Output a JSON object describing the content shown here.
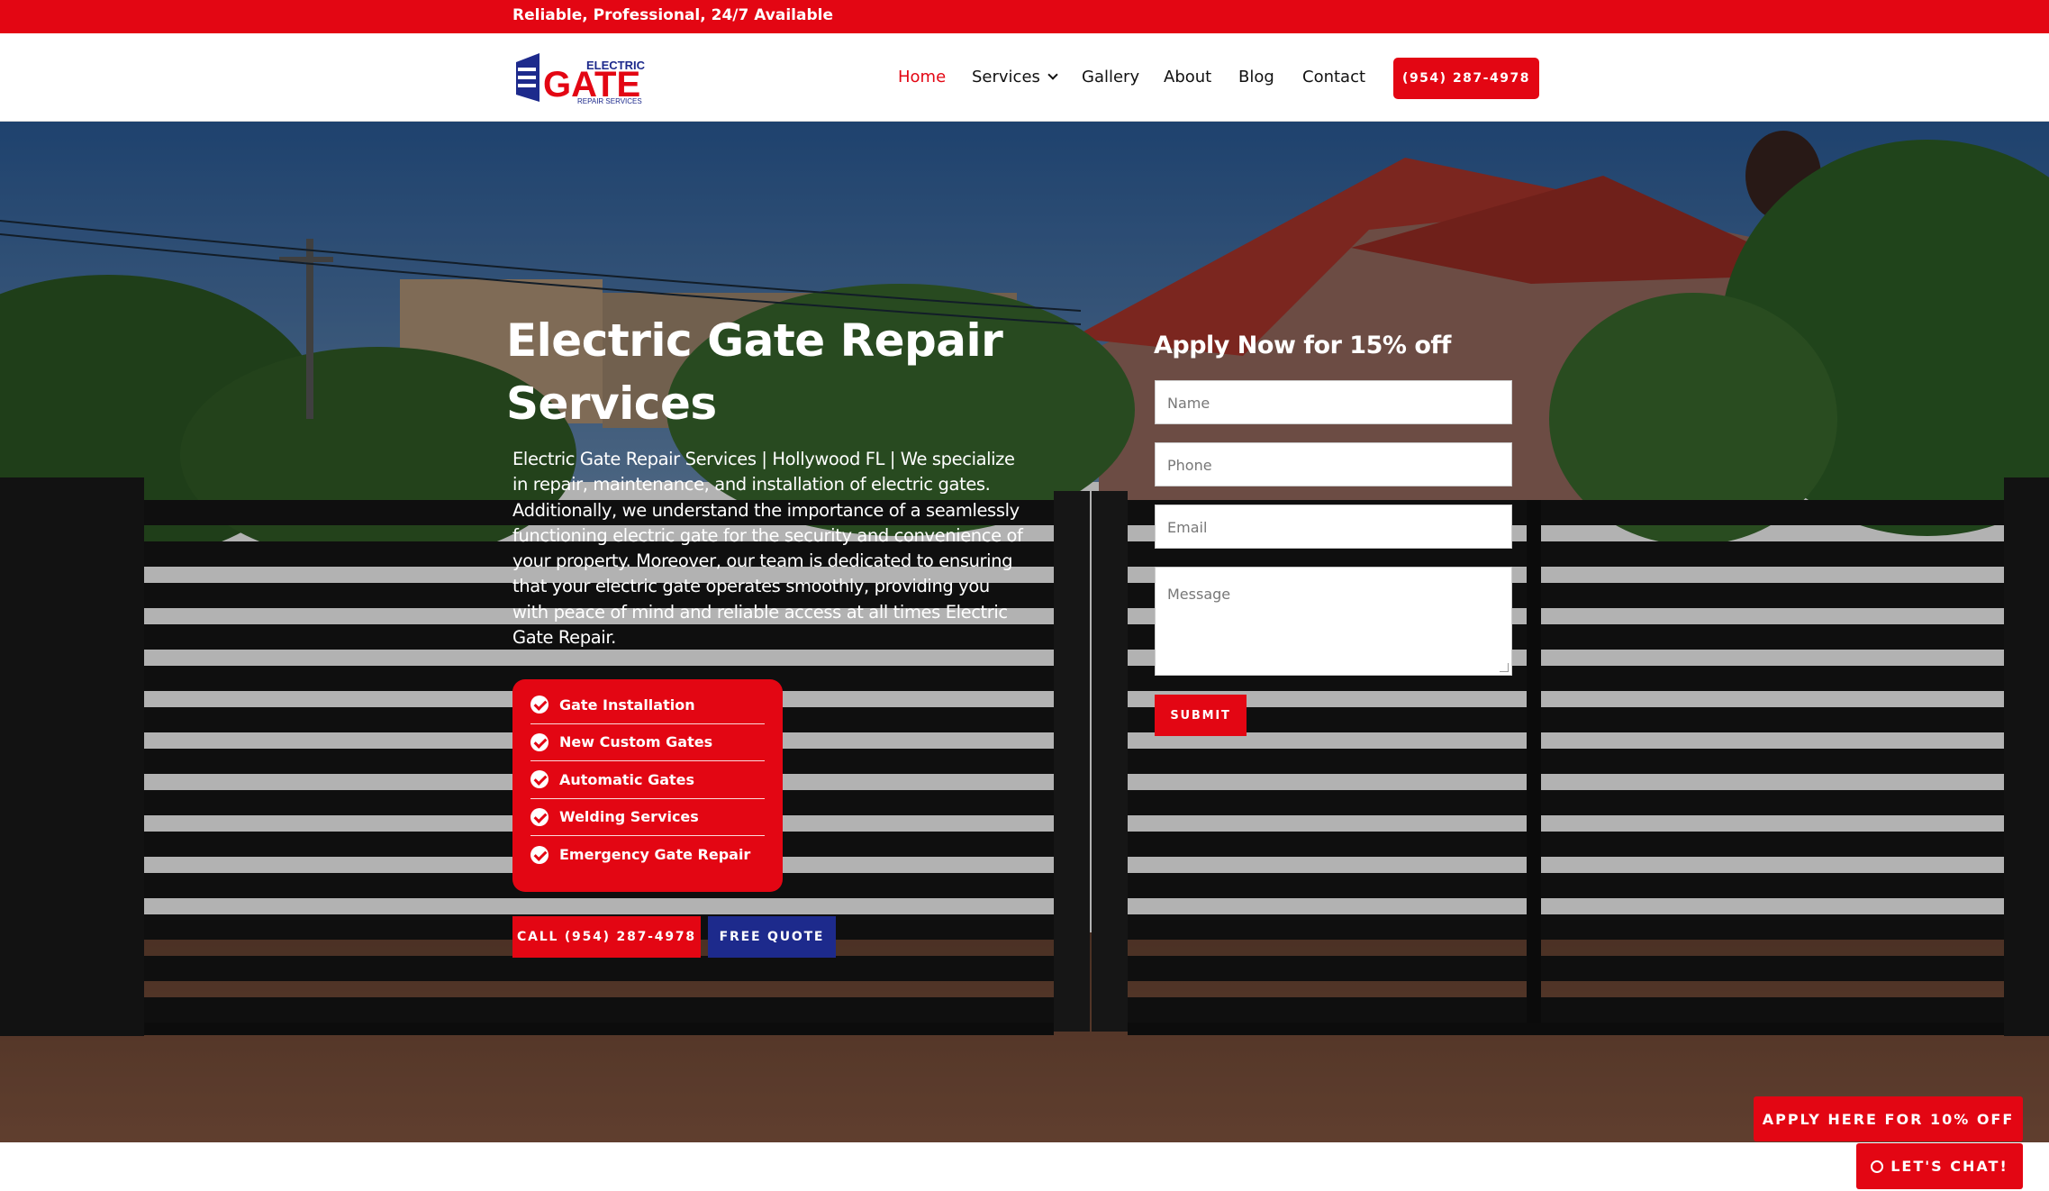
{
  "topbar": {
    "tagline": "Reliable, Professional, 24/7 Available"
  },
  "header": {
    "logo": {
      "word_small": "ELECTRIC",
      "word_big": "GATE",
      "sub": "REPAIR SERVICES"
    },
    "nav": [
      {
        "label": "Home",
        "active": true
      },
      {
        "label": "Services",
        "has_dropdown": true
      },
      {
        "label": "Gallery"
      },
      {
        "label": "About"
      },
      {
        "label": "Blog"
      },
      {
        "label": "Contact"
      }
    ],
    "phone_label": "(954) 287-4978"
  },
  "hero": {
    "title": "Electric Gate Repair Services",
    "description": "Electric Gate Repair Services | Hollywood FL | We specialize in repair, maintenance, and installation of electric gates. Additionally, we understand the importance of a seamlessly functioning electric gate for the security and convenience of your property. Moreover, our team is dedicated to ensuring that your electric gate operates smoothly, providing you with peace of mind and reliable access at all times Electric Gate Repair.",
    "features": [
      "Gate Installation",
      "New Custom Gates",
      "Automatic Gates",
      "Welding Services",
      "Emergency Gate Repair"
    ],
    "cta_call": "CALL (954) 287-4978",
    "cta_quote": "FREE QUOTE"
  },
  "form": {
    "title": "Apply Now for 15% off",
    "name_placeholder": "Name",
    "phone_placeholder": "Phone",
    "email_placeholder": "Email",
    "message_placeholder": "Message",
    "submit_label": "SUBMIT"
  },
  "floating": {
    "apply_label": "APPLY HERE FOR 10% OFF",
    "chat_label": "LET'S CHAT!"
  },
  "colors": {
    "brand_red": "#e30613",
    "brand_navy": "#1d2a8c"
  }
}
